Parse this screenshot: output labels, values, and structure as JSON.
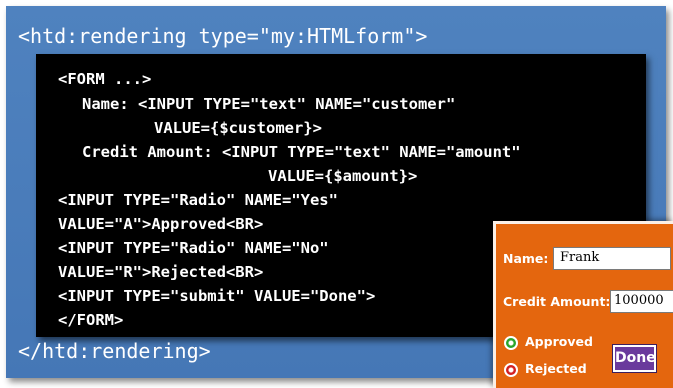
{
  "slide": {
    "open_tag": "<htd:rendering type=\"my:HTMLform\">",
    "close_tag": "</htd:rendering>",
    "code_lines": [
      "<FORM ...>",
      "Name: <INPUT TYPE=\"text\" NAME=\"customer\"",
      "VALUE={$customer}>",
      "Credit Amount: <INPUT TYPE=\"text\" NAME=\"amount\"",
      "VALUE={$amount}>",
      "<INPUT TYPE=\"Radio\" NAME=\"Yes\"",
      "VALUE=\"A\">Approved<BR>",
      "<INPUT TYPE=\"Radio\" NAME=\"No\"",
      "VALUE=\"R\">Rejected<BR>",
      "<INPUT TYPE=\"submit\" VALUE=\"Done\">",
      "</FORM>"
    ]
  },
  "form": {
    "name_label": "Name:",
    "name_value": "Frank",
    "amount_label": "Credit Amount:",
    "amount_value": "100000",
    "approved_label": "Approved",
    "rejected_label": "Rejected",
    "done_label": "Done"
  }
}
